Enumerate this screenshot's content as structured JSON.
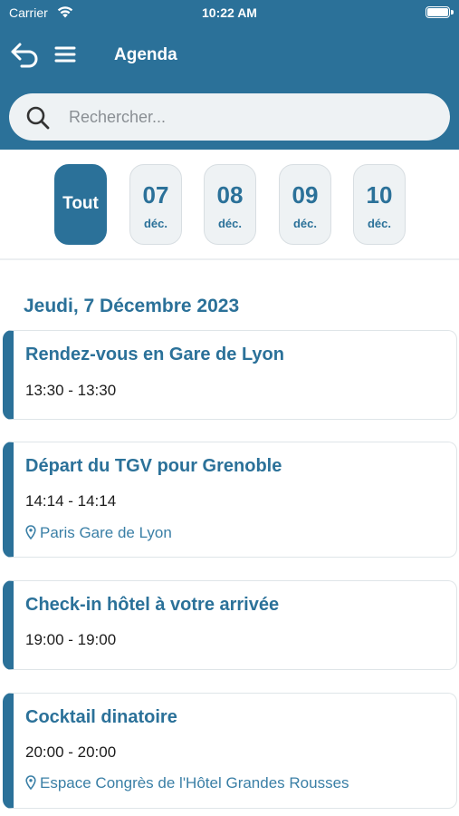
{
  "status_bar": {
    "carrier": "Carrier",
    "time": "10:22 AM"
  },
  "header": {
    "title": "Agenda"
  },
  "search": {
    "placeholder": "Rechercher..."
  },
  "date_filter": {
    "all_label": "Tout",
    "dates": [
      {
        "day": "07",
        "month": "déc."
      },
      {
        "day": "08",
        "month": "déc."
      },
      {
        "day": "09",
        "month": "déc."
      },
      {
        "day": "10",
        "month": "déc."
      }
    ]
  },
  "agenda": {
    "day_heading": "Jeudi, 7 Décembre 2023",
    "events": [
      {
        "title": "Rendez-vous en Gare de Lyon",
        "time": "13:30 - 13:30",
        "location": ""
      },
      {
        "title": "Départ du TGV pour Grenoble",
        "time": "14:14 - 14:14",
        "location": "Paris Gare de Lyon"
      },
      {
        "title": "Check-in hôtel à votre arrivée",
        "time": "19:00 - 19:00",
        "location": ""
      },
      {
        "title": "Cocktail dinatoire",
        "time": "20:00 - 20:00",
        "location": "Espace Congrès de l'Hôtel Grandes Rousses"
      }
    ]
  },
  "colors": {
    "primary": "#2b7199",
    "chip_bg": "#eef2f4",
    "location_text": "#3a7fa6"
  },
  "icons": {
    "back": "undo-arrow-icon",
    "menu": "hamburger-menu-icon",
    "search": "magnifier-icon",
    "location": "map-pin-icon"
  }
}
